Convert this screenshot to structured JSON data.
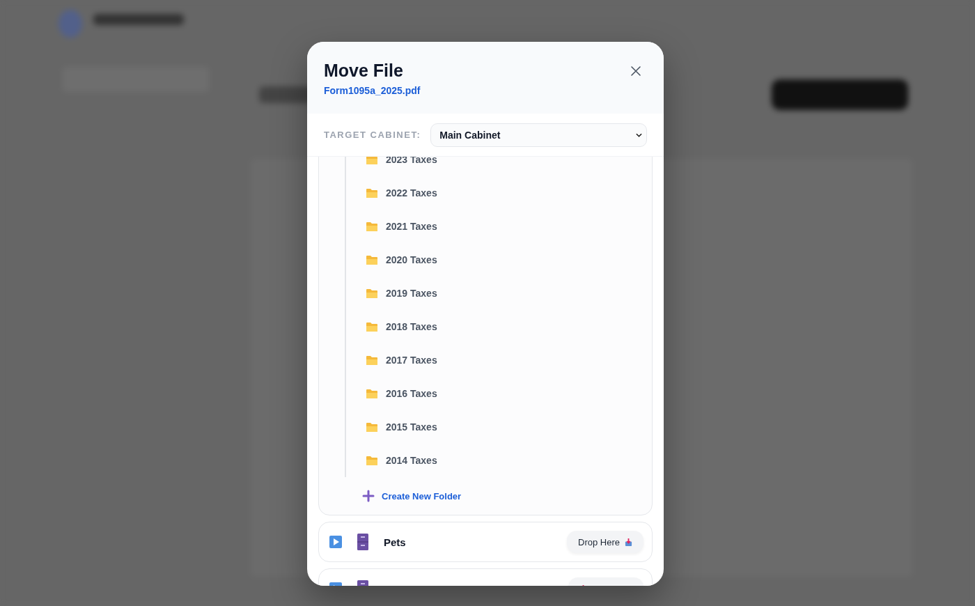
{
  "dialog": {
    "title": "Move File",
    "file_name": "Form1095a_2025.pdf"
  },
  "target_cabinet": {
    "label": "TARGET CABINET:",
    "value": "Main Cabinet"
  },
  "cabinets": [
    {
      "expanded": true,
      "folders": [
        "2023 Taxes",
        "2022 Taxes",
        "2021 Taxes",
        "2020 Taxes",
        "2019 Taxes",
        "2018 Taxes",
        "2017 Taxes",
        "2016 Taxes",
        "2015 Taxes",
        "2014 Taxes"
      ],
      "create_folder_label": "Create New Folder"
    },
    {
      "expanded": false,
      "name": "Pets",
      "drop_label": "Drop Here"
    },
    {
      "expanded": false
    }
  ]
}
